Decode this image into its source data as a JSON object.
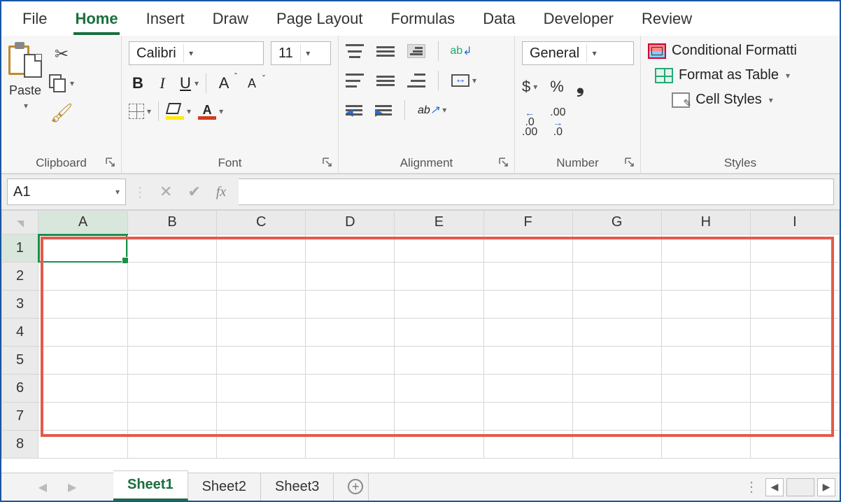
{
  "tabs": {
    "file": "File",
    "home": "Home",
    "insert": "Insert",
    "draw": "Draw",
    "page_layout": "Page Layout",
    "formulas": "Formulas",
    "data": "Data",
    "developer": "Developer",
    "review": "Review",
    "active": "Home"
  },
  "ribbon": {
    "clipboard": {
      "label": "Clipboard",
      "paste": "Paste"
    },
    "font": {
      "label": "Font",
      "name": "Calibri",
      "size": "11",
      "bold": "B",
      "italic": "I",
      "underline": "U",
      "grow": "A",
      "shrink": "A",
      "font_color_letter": "A"
    },
    "alignment": {
      "label": "Alignment",
      "wrap": "ab",
      "orientation": "ab"
    },
    "number": {
      "label": "Number",
      "format": "General",
      "currency": "$",
      "percent": "%",
      "comma": "❟",
      "inc_dec": ".00",
      "inc_dec2": ".0",
      "dec_inc": ".0",
      "dec_inc2": ".00"
    },
    "styles": {
      "label": "Styles",
      "conditional": "Conditional Formatti",
      "format_table": "Format as Table",
      "cell_styles": "Cell Styles"
    }
  },
  "formula_bar": {
    "name_box": "A1",
    "fx": "fx",
    "value": ""
  },
  "grid": {
    "columns": [
      "A",
      "B",
      "C",
      "D",
      "E",
      "F",
      "G",
      "H",
      "I"
    ],
    "rows": [
      "1",
      "2",
      "3",
      "4",
      "5",
      "6",
      "7",
      "8"
    ],
    "selected_cell": "A1"
  },
  "sheet_tabs": {
    "sheets": [
      "Sheet1",
      "Sheet2",
      "Sheet3"
    ],
    "active": "Sheet1"
  }
}
